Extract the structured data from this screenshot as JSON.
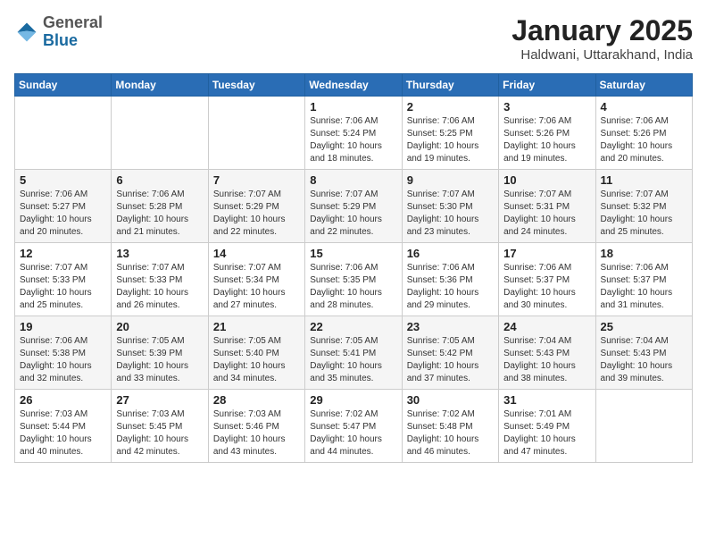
{
  "header": {
    "logo": {
      "general": "General",
      "blue": "Blue"
    },
    "title": "January 2025",
    "location": "Haldwani, Uttarakhand, India"
  },
  "calendar": {
    "days_of_week": [
      "Sunday",
      "Monday",
      "Tuesday",
      "Wednesday",
      "Thursday",
      "Friday",
      "Saturday"
    ],
    "weeks": [
      [
        {
          "day": "",
          "info": ""
        },
        {
          "day": "",
          "info": ""
        },
        {
          "day": "",
          "info": ""
        },
        {
          "day": "1",
          "info": "Sunrise: 7:06 AM\nSunset: 5:24 PM\nDaylight: 10 hours\nand 18 minutes."
        },
        {
          "day": "2",
          "info": "Sunrise: 7:06 AM\nSunset: 5:25 PM\nDaylight: 10 hours\nand 19 minutes."
        },
        {
          "day": "3",
          "info": "Sunrise: 7:06 AM\nSunset: 5:26 PM\nDaylight: 10 hours\nand 19 minutes."
        },
        {
          "day": "4",
          "info": "Sunrise: 7:06 AM\nSunset: 5:26 PM\nDaylight: 10 hours\nand 20 minutes."
        }
      ],
      [
        {
          "day": "5",
          "info": "Sunrise: 7:06 AM\nSunset: 5:27 PM\nDaylight: 10 hours\nand 20 minutes."
        },
        {
          "day": "6",
          "info": "Sunrise: 7:06 AM\nSunset: 5:28 PM\nDaylight: 10 hours\nand 21 minutes."
        },
        {
          "day": "7",
          "info": "Sunrise: 7:07 AM\nSunset: 5:29 PM\nDaylight: 10 hours\nand 22 minutes."
        },
        {
          "day": "8",
          "info": "Sunrise: 7:07 AM\nSunset: 5:29 PM\nDaylight: 10 hours\nand 22 minutes."
        },
        {
          "day": "9",
          "info": "Sunrise: 7:07 AM\nSunset: 5:30 PM\nDaylight: 10 hours\nand 23 minutes."
        },
        {
          "day": "10",
          "info": "Sunrise: 7:07 AM\nSunset: 5:31 PM\nDaylight: 10 hours\nand 24 minutes."
        },
        {
          "day": "11",
          "info": "Sunrise: 7:07 AM\nSunset: 5:32 PM\nDaylight: 10 hours\nand 25 minutes."
        }
      ],
      [
        {
          "day": "12",
          "info": "Sunrise: 7:07 AM\nSunset: 5:33 PM\nDaylight: 10 hours\nand 25 minutes."
        },
        {
          "day": "13",
          "info": "Sunrise: 7:07 AM\nSunset: 5:33 PM\nDaylight: 10 hours\nand 26 minutes."
        },
        {
          "day": "14",
          "info": "Sunrise: 7:07 AM\nSunset: 5:34 PM\nDaylight: 10 hours\nand 27 minutes."
        },
        {
          "day": "15",
          "info": "Sunrise: 7:06 AM\nSunset: 5:35 PM\nDaylight: 10 hours\nand 28 minutes."
        },
        {
          "day": "16",
          "info": "Sunrise: 7:06 AM\nSunset: 5:36 PM\nDaylight: 10 hours\nand 29 minutes."
        },
        {
          "day": "17",
          "info": "Sunrise: 7:06 AM\nSunset: 5:37 PM\nDaylight: 10 hours\nand 30 minutes."
        },
        {
          "day": "18",
          "info": "Sunrise: 7:06 AM\nSunset: 5:37 PM\nDaylight: 10 hours\nand 31 minutes."
        }
      ],
      [
        {
          "day": "19",
          "info": "Sunrise: 7:06 AM\nSunset: 5:38 PM\nDaylight: 10 hours\nand 32 minutes."
        },
        {
          "day": "20",
          "info": "Sunrise: 7:05 AM\nSunset: 5:39 PM\nDaylight: 10 hours\nand 33 minutes."
        },
        {
          "day": "21",
          "info": "Sunrise: 7:05 AM\nSunset: 5:40 PM\nDaylight: 10 hours\nand 34 minutes."
        },
        {
          "day": "22",
          "info": "Sunrise: 7:05 AM\nSunset: 5:41 PM\nDaylight: 10 hours\nand 35 minutes."
        },
        {
          "day": "23",
          "info": "Sunrise: 7:05 AM\nSunset: 5:42 PM\nDaylight: 10 hours\nand 37 minutes."
        },
        {
          "day": "24",
          "info": "Sunrise: 7:04 AM\nSunset: 5:43 PM\nDaylight: 10 hours\nand 38 minutes."
        },
        {
          "day": "25",
          "info": "Sunrise: 7:04 AM\nSunset: 5:43 PM\nDaylight: 10 hours\nand 39 minutes."
        }
      ],
      [
        {
          "day": "26",
          "info": "Sunrise: 7:03 AM\nSunset: 5:44 PM\nDaylight: 10 hours\nand 40 minutes."
        },
        {
          "day": "27",
          "info": "Sunrise: 7:03 AM\nSunset: 5:45 PM\nDaylight: 10 hours\nand 42 minutes."
        },
        {
          "day": "28",
          "info": "Sunrise: 7:03 AM\nSunset: 5:46 PM\nDaylight: 10 hours\nand 43 minutes."
        },
        {
          "day": "29",
          "info": "Sunrise: 7:02 AM\nSunset: 5:47 PM\nDaylight: 10 hours\nand 44 minutes."
        },
        {
          "day": "30",
          "info": "Sunrise: 7:02 AM\nSunset: 5:48 PM\nDaylight: 10 hours\nand 46 minutes."
        },
        {
          "day": "31",
          "info": "Sunrise: 7:01 AM\nSunset: 5:49 PM\nDaylight: 10 hours\nand 47 minutes."
        },
        {
          "day": "",
          "info": ""
        }
      ]
    ]
  }
}
